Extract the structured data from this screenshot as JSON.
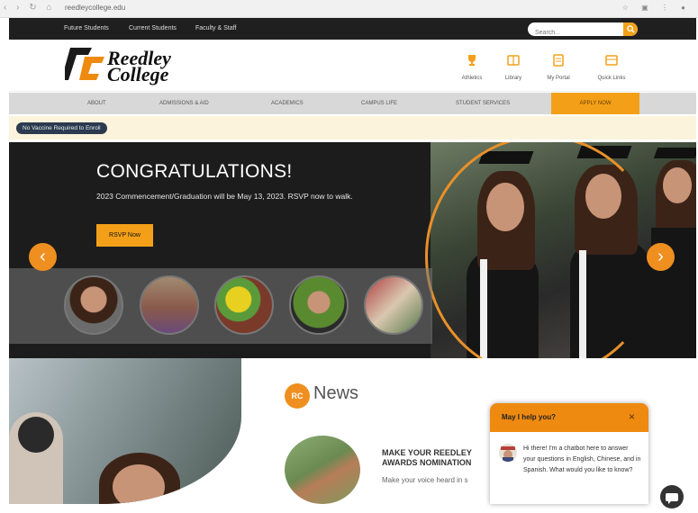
{
  "browser": {
    "url": "reedleycollege.edu"
  },
  "topnav": {
    "links": [
      "Future Students",
      "Current Students",
      "Faculty & Staff"
    ],
    "search_placeholder": "Search..."
  },
  "header": {
    "logo_line1": "Reedley",
    "logo_line2": "College",
    "quick_links": [
      {
        "label": "Athletics",
        "icon": "trophy-icon"
      },
      {
        "label": "Library",
        "icon": "book-icon"
      },
      {
        "label": "My Portal",
        "icon": "portal-icon"
      },
      {
        "label": "Quick Links",
        "icon": "grid-icon"
      }
    ]
  },
  "mainnav": {
    "items": [
      "ABOUT",
      "ADMISSIONS & AID",
      "ACADEMICS",
      "CAMPUS LIFE",
      "STUDENT SERVICES"
    ],
    "apply": "APPLY NOW"
  },
  "alert": {
    "vaccine_badge": "No Vaccine Required to Enroll"
  },
  "hero": {
    "title": "CONGRATULATIONS!",
    "subtitle": "2023 Commencement/Graduation will be May 13, 2023. RSVP now to walk.",
    "cta": "RSVP Now"
  },
  "news": {
    "icon_text": "RC",
    "title": "News",
    "headline_line1": "MAKE YOUR REEDLEY",
    "headline_line2": "AWARDS NOMINATION",
    "body": "Make your voice heard in s"
  },
  "chat": {
    "title": "May I help you?",
    "close": "×",
    "message": "Hi there! I'm a chatbot here to answer your questions in English, Chinese, and in Spanish. What would you like to know?"
  },
  "colors": {
    "accent": "#f3a018",
    "dark": "#1f1f1f",
    "navy_badge": "#2b3a4f"
  }
}
